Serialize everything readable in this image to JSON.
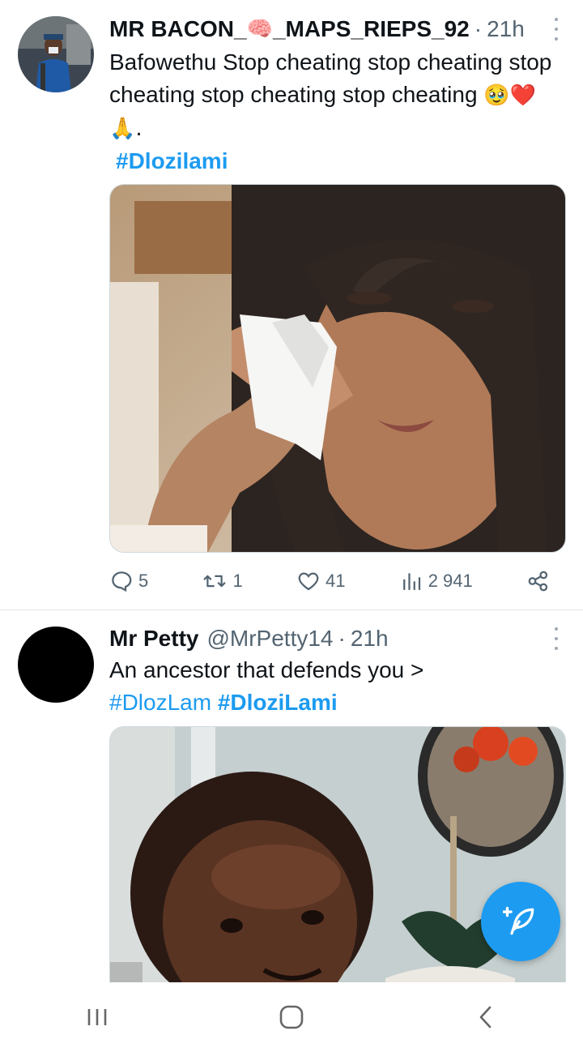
{
  "tweets": [
    {
      "name_part1": "MR BACON_",
      "name_emoji": "🧠",
      "name_part2": "_MAPS_RIEPS_92",
      "dot": "·",
      "time": "21h",
      "text": "Bafowethu Stop cheating stop cheating stop cheating stop cheating stop cheating",
      "emojis": "🥹❤️🙏.",
      "hashtag": "#Dlozilami",
      "stats": {
        "replies": "5",
        "retweets": "1",
        "likes": "41",
        "views": "2 941"
      }
    },
    {
      "name": "Mr Petty",
      "handle": "@MrPetty14",
      "dot": "·",
      "time": "21h",
      "text": "An ancestor that defends you >",
      "hashtag1": "#DlozLam",
      "hashtag2": "#DloziLami"
    }
  ],
  "colors": {
    "accent": "#1d9bf0",
    "text": "#0f1419",
    "muted": "#536471"
  }
}
